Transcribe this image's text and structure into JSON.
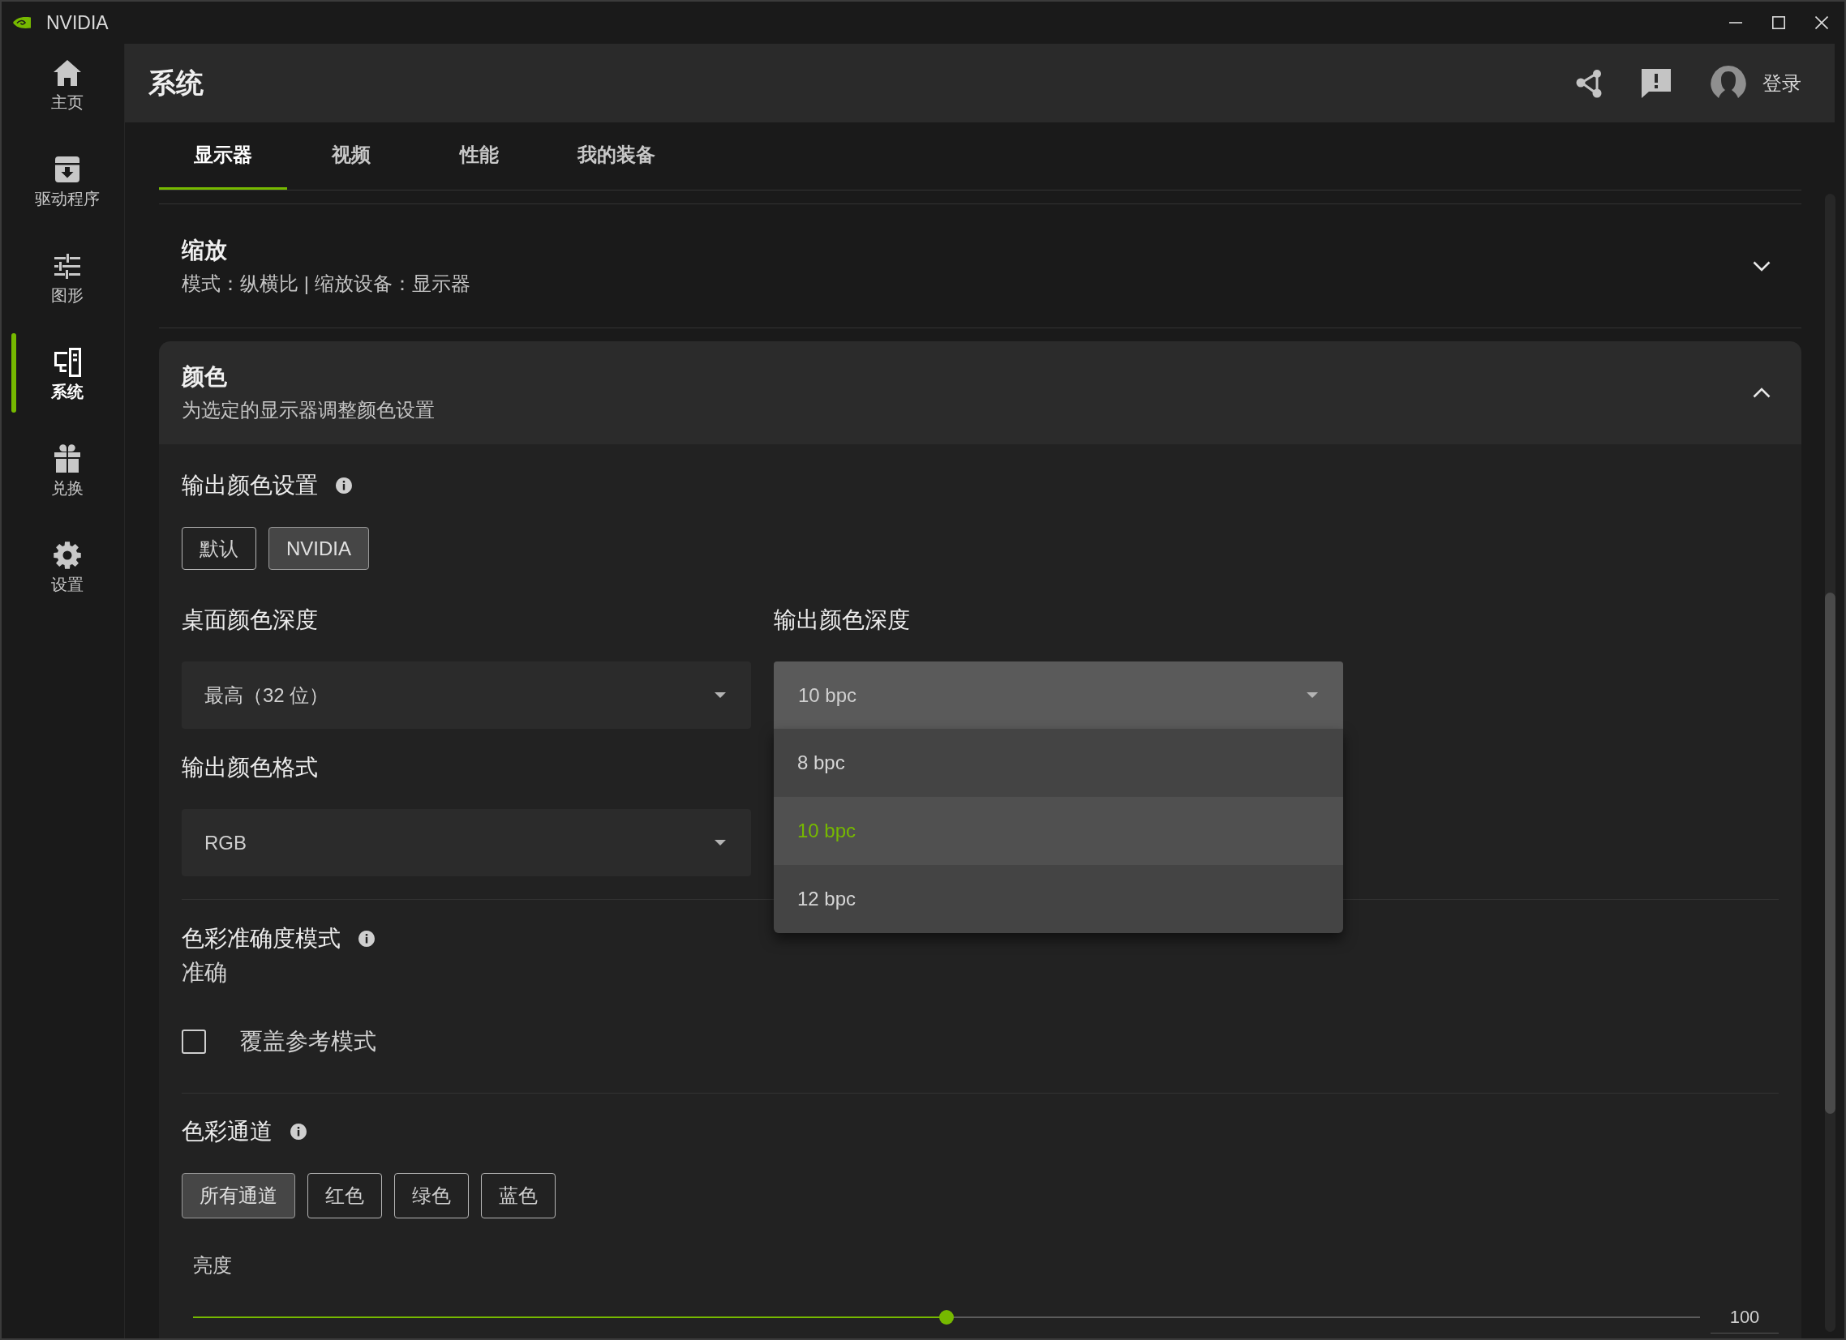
{
  "window": {
    "title": "NVIDIA"
  },
  "sidebar": {
    "items": [
      {
        "label": "主页",
        "selected": false
      },
      {
        "label": "驱动程序",
        "selected": false
      },
      {
        "label": "图形",
        "selected": false
      },
      {
        "label": "系统",
        "selected": true
      },
      {
        "label": "兑换",
        "selected": false
      },
      {
        "label": "设置",
        "selected": false
      }
    ]
  },
  "header": {
    "title": "系统",
    "login": "登录"
  },
  "tabs": [
    {
      "label": "显示器",
      "selected": true
    },
    {
      "label": "视频",
      "selected": false
    },
    {
      "label": "性能",
      "selected": false
    },
    {
      "label": "我的装备",
      "selected": false
    }
  ],
  "sections": [
    {
      "title": "缩放",
      "subtitle": "模式：纵横比 | 缩放设备：显示器",
      "expanded": false
    },
    {
      "title": "颜色",
      "subtitle": "为选定的显示器调整颜色设置",
      "expanded": true,
      "output_color_settings": {
        "label": "输出颜色设置",
        "options": [
          {
            "label": "默认",
            "selected": false
          },
          {
            "label": "NVIDIA",
            "selected": true
          }
        ]
      },
      "dropdowns": [
        {
          "label": "桌面颜色深度",
          "value": "最高（32 位）",
          "expanded": false
        },
        {
          "label": "输出颜色深度",
          "value": "10 bpc",
          "expanded": true,
          "options": [
            {
              "label": "8 bpc",
              "selected": false
            },
            {
              "label": "10 bpc",
              "selected": true
            },
            {
              "label": "12 bpc",
              "selected": false
            }
          ]
        },
        {
          "label": "输出颜色格式",
          "value": "RGB",
          "expanded": false
        }
      ],
      "accuracy_mode": {
        "label": "色彩准确度模式",
        "value": "准确",
        "override": {
          "label": "覆盖参考模式",
          "checked": false
        }
      },
      "color_channels": {
        "label": "色彩通道",
        "options": [
          {
            "label": "所有通道",
            "selected": true
          },
          {
            "label": "红色",
            "selected": false
          },
          {
            "label": "绿色",
            "selected": false
          },
          {
            "label": "蓝色",
            "selected": false
          }
        ],
        "brightness": {
          "label": "亮度",
          "level": 0.5,
          "reading": "100"
        }
      }
    }
  ]
}
